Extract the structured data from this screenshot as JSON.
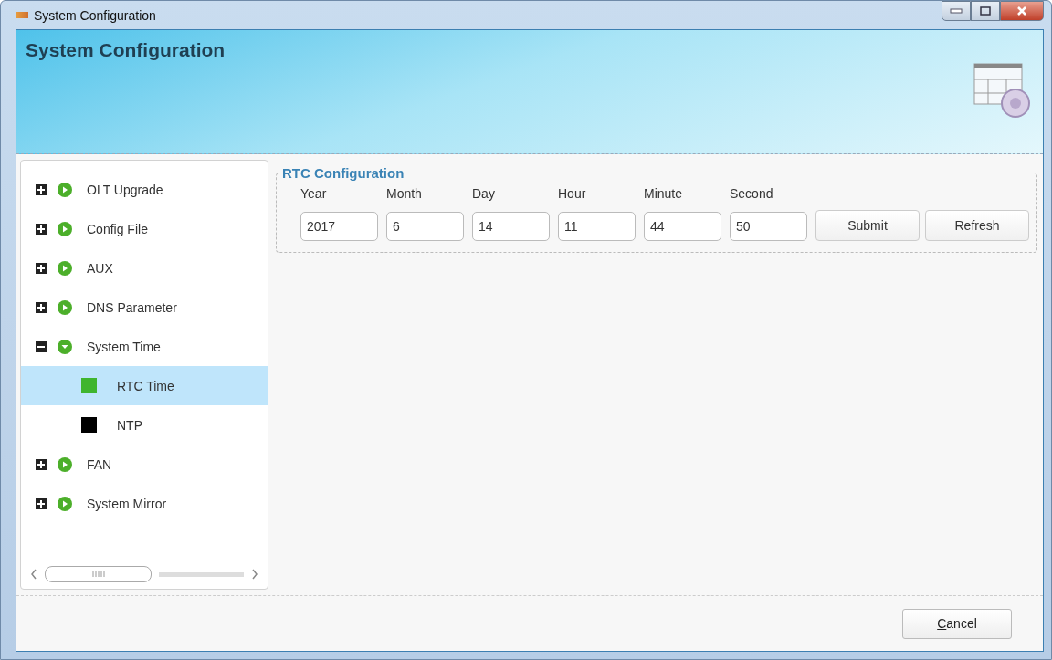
{
  "window": {
    "title": "System Configuration"
  },
  "header": {
    "title": "System Configuration"
  },
  "tree": [
    {
      "label": "OLT Upgrade",
      "expanded": false,
      "selected": false
    },
    {
      "label": "Config File",
      "expanded": false,
      "selected": false
    },
    {
      "label": "AUX",
      "expanded": false,
      "selected": false
    },
    {
      "label": "DNS Parameter",
      "expanded": false,
      "selected": false
    },
    {
      "label": "System Time",
      "expanded": true,
      "selected": false,
      "children": [
        {
          "label": "RTC Time",
          "selected": true
        },
        {
          "label": "NTP",
          "selected": false
        }
      ]
    },
    {
      "label": "FAN",
      "expanded": false,
      "selected": false
    },
    {
      "label": "System Mirror",
      "expanded": false,
      "selected": false
    }
  ],
  "rtc": {
    "title": "RTC Configuration",
    "fields": [
      {
        "label": "Year",
        "value": "2017"
      },
      {
        "label": "Month",
        "value": "6"
      },
      {
        "label": "Day",
        "value": "14"
      },
      {
        "label": "Hour",
        "value": "11"
      },
      {
        "label": "Minute",
        "value": "44"
      },
      {
        "label": "Second",
        "value": "50"
      }
    ],
    "buttons": [
      "Submit",
      "Refresh"
    ]
  },
  "footer": {
    "buttons": [
      "Cancel"
    ]
  }
}
